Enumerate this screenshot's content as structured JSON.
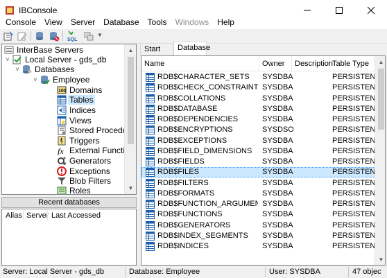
{
  "window": {
    "title": "IBConsole"
  },
  "menu": [
    "Console",
    "View",
    "Server",
    "Database",
    "Tools",
    "Windows",
    "Help"
  ],
  "tree": {
    "root": "InterBase Servers",
    "server": "Local Server - gds_db",
    "databases": "Databases",
    "db": "Employee",
    "items": [
      "Domains",
      "Tables",
      "Indices",
      "Views",
      "Stored Procedures",
      "Triggers",
      "External Functions",
      "Generators",
      "Exceptions",
      "Blob Filters",
      "Roles"
    ],
    "selected_index": 1
  },
  "recent": {
    "label": "Recent databases",
    "columns": [
      "Alias",
      "Server",
      "Last Accessed"
    ]
  },
  "tabs": [
    "Start Here",
    "Database"
  ],
  "grid": {
    "columns": [
      "Name",
      "Owner",
      "Description",
      "Table Type"
    ],
    "rows": [
      [
        "RDB$CHARACTER_SETS",
        "SYSDBA",
        "",
        "PERSISTENT"
      ],
      [
        "RDB$CHECK_CONSTRAINTS",
        "SYSDBA",
        "",
        "PERSISTENT"
      ],
      [
        "RDB$COLLATIONS",
        "SYSDBA",
        "",
        "PERSISTENT"
      ],
      [
        "RDB$DATABASE",
        "SYSDBA",
        "",
        "PERSISTENT"
      ],
      [
        "RDB$DEPENDENCIES",
        "SYSDBA",
        "",
        "PERSISTENT"
      ],
      [
        "RDB$ENCRYPTIONS",
        "SYSDSO",
        "",
        "PERSISTENT"
      ],
      [
        "RDB$EXCEPTIONS",
        "SYSDBA",
        "",
        "PERSISTENT"
      ],
      [
        "RDB$FIELD_DIMENSIONS",
        "SYSDBA",
        "",
        "PERSISTENT"
      ],
      [
        "RDB$FIELDS",
        "SYSDBA",
        "",
        "PERSISTENT"
      ],
      [
        "RDB$FILES",
        "SYSDBA",
        "",
        "PERSISTENT"
      ],
      [
        "RDB$FILTERS",
        "SYSDBA",
        "",
        "PERSISTENT"
      ],
      [
        "RDB$FORMATS",
        "SYSDBA",
        "",
        "PERSISTENT"
      ],
      [
        "RDB$FUNCTION_ARGUMENTS",
        "SYSDBA",
        "",
        "PERSISTENT"
      ],
      [
        "RDB$FUNCTIONS",
        "SYSDBA",
        "",
        "PERSISTENT"
      ],
      [
        "RDB$GENERATORS",
        "SYSDBA",
        "",
        "PERSISTENT"
      ],
      [
        "RDB$INDEX_SEGMENTS",
        "SYSDBA",
        "",
        "PERSISTENT"
      ],
      [
        "RDB$INDICES",
        "SYSDBA",
        "",
        "PERSISTENT"
      ]
    ],
    "selected_index": 9
  },
  "status": {
    "server": "Server: Local Server - gds_db",
    "database": "Database: Employee",
    "user": "User: SYSDBA",
    "count": "47 objec"
  },
  "colors": {
    "selection": "#cce8ff",
    "accent": "#0078d7"
  }
}
